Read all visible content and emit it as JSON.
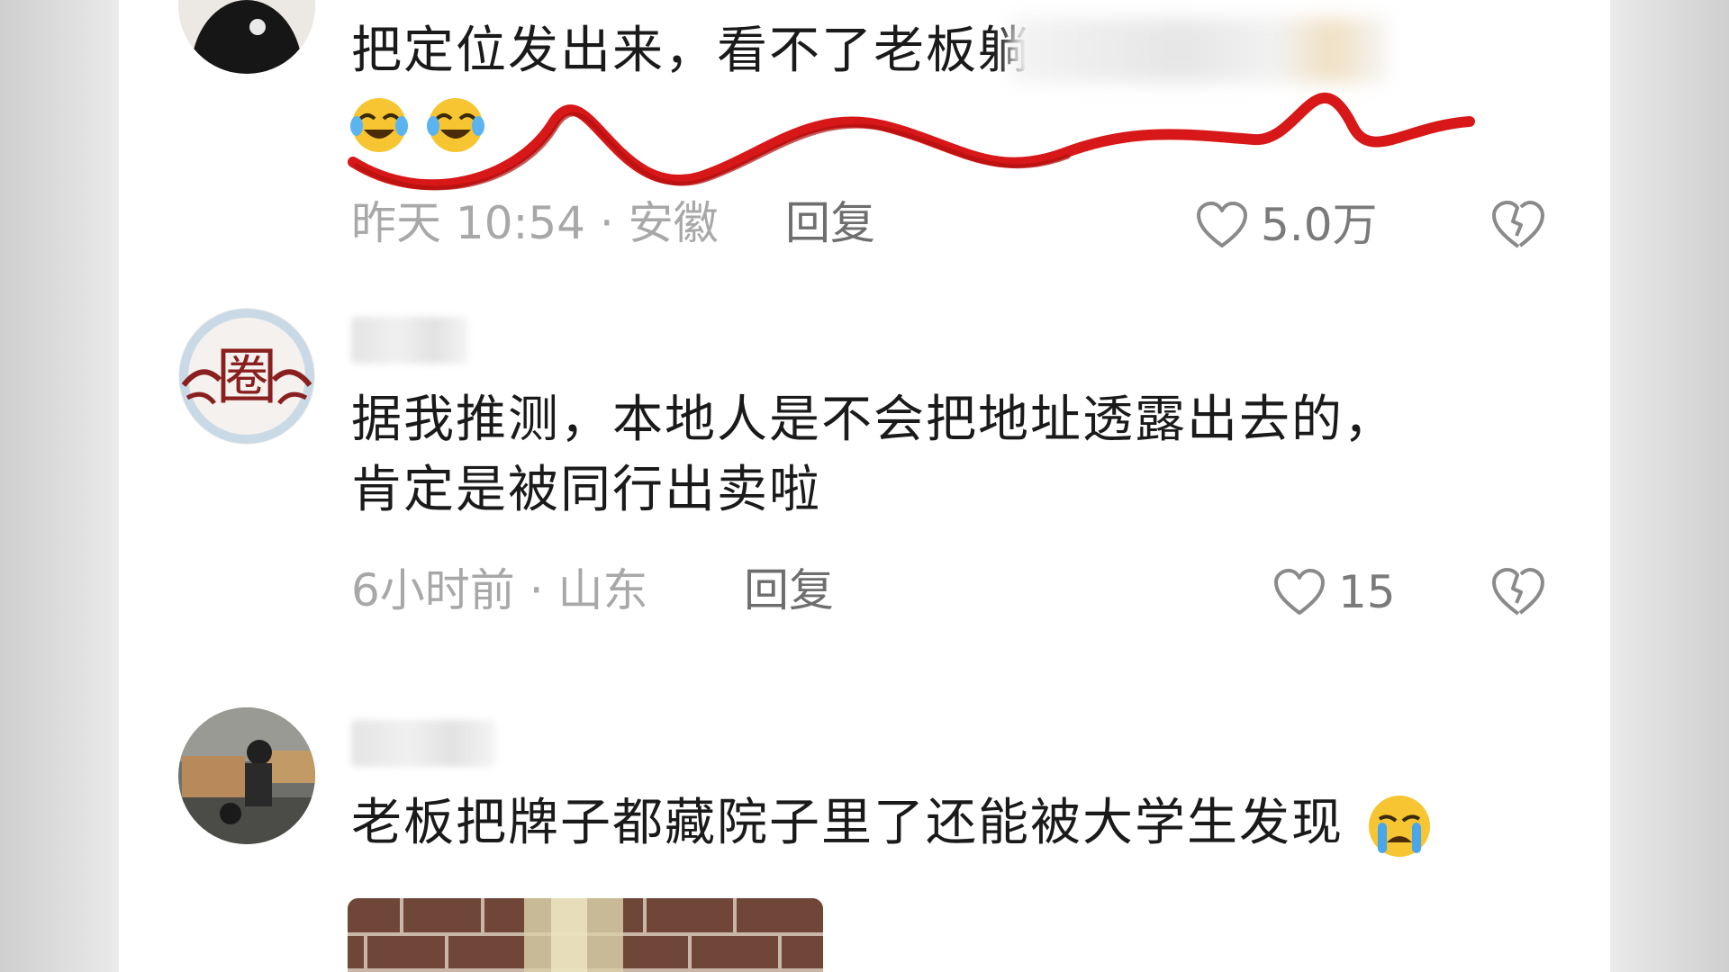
{
  "comments": [
    {
      "text_line1": "把定位发出来，看不了老板躺",
      "time": "昨天 10:54 · 安徽",
      "reply": "回复",
      "likes": "5.0万",
      "emojis": [
        "laughing-crying-emoji",
        "laughing-crying-emoji"
      ]
    },
    {
      "text_line1": "据我推测，本地人是不会把地址透露出去的，",
      "text_line2": "肯定是被同行出卖啦",
      "time": "6小时前 · 山东",
      "reply": "回复",
      "likes": "15",
      "avatar_glyph": "圈"
    },
    {
      "text_line1": "老板把牌子都藏院子里了还能被大学生发现",
      "emojis": [
        "crying-emoji"
      ]
    }
  ],
  "colors": {
    "annotation_red": "#d81818",
    "meta_gray": "#a8a8a8",
    "text": "#1a1a1a"
  }
}
